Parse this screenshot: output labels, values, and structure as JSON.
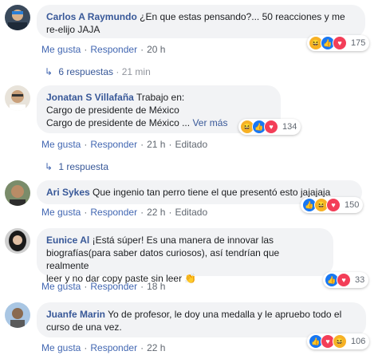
{
  "actions": {
    "like": "Me gusta",
    "reply": "Responder",
    "edited": "Editado"
  },
  "comments": [
    {
      "author": "Carlos A Raymundo",
      "text": "¿En que estas pensando?... 50 reacciones y me re-elijo JAJA",
      "time": "20 h",
      "reaction_count": "175",
      "reactions": [
        "haha-icon",
        "like-icon",
        "love-icon"
      ],
      "replies": {
        "label": "6 respuestas",
        "time": "21 min"
      }
    },
    {
      "author": "Jonatan S Villafaña",
      "text": "Trabajo en: Cargo de presidente de México Cargo de presidente de México ...",
      "lines": [
        "Trabajo en:",
        "Cargo de presidente de México",
        "Cargo de presidente de México ..."
      ],
      "more": "Ver más",
      "time": "21 h",
      "edited": true,
      "reaction_count": "134",
      "reactions": [
        "haha-icon",
        "like-icon",
        "love-icon"
      ],
      "replies": {
        "label": "1 respuesta"
      }
    },
    {
      "author": "Ari Sykes",
      "text": "Que ingenio tan perro tiene el que presentó esto jajajaja",
      "time": "22 h",
      "edited": true,
      "reaction_count": "150",
      "reactions": [
        "like-icon",
        "haha-icon",
        "love-icon"
      ]
    },
    {
      "author": "Eunice Al",
      "text": "¡Está súper! Es una manera de innovar las biografías(para saber datos curiosos), así tendrían que realmente leer y no dar copy paste sin leer 👏",
      "lines": [
        "¡Está súper! Es una manera de innovar las",
        "biografías(para saber datos curiosos), así tendrían que realmente",
        "leer y no dar copy paste sin leer 👏"
      ],
      "time": "18 h",
      "reaction_count": "33",
      "reactions": [
        "like-icon",
        "love-icon"
      ]
    },
    {
      "author": "Juanfe Marin",
      "text": "Yo de profesor, le doy una medalla y le apruebo todo el curso de una vez.",
      "time": "22 h",
      "reaction_count": "106",
      "reactions": [
        "like-icon",
        "love-icon",
        "haha-icon"
      ]
    }
  ],
  "colors": {
    "link": "#385898",
    "bubble": "#f2f3f5",
    "like": "#1877f2",
    "love": "#f33e58",
    "haha": "#f7b125"
  }
}
